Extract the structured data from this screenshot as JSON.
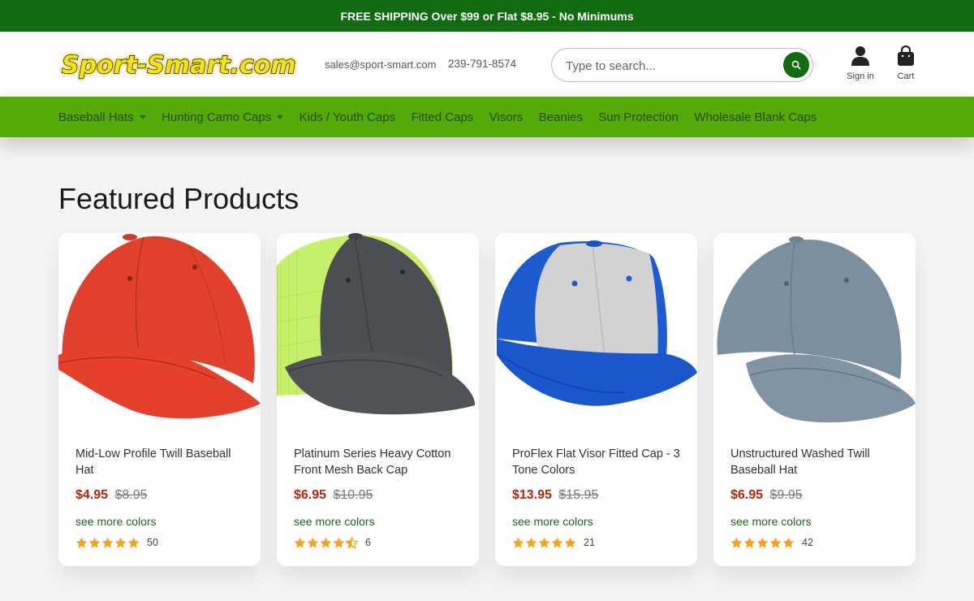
{
  "promo": {
    "text": "FREE SHIPPING Over $99 or Flat $8.95 - No Minimums"
  },
  "header": {
    "logo_text": "Sport-Smart.com",
    "email": "sales@sport-smart.com",
    "phone": "239-791-8574",
    "search_placeholder": "Type to search...",
    "signin_label": "Sign in",
    "cart_label": "Cart"
  },
  "nav": {
    "items": [
      {
        "label": "Baseball Hats",
        "dropdown": true
      },
      {
        "label": "Hunting Camo Caps",
        "dropdown": true
      },
      {
        "label": "Kids / Youth Caps",
        "dropdown": false
      },
      {
        "label": "Fitted Caps",
        "dropdown": false
      },
      {
        "label": "Visors",
        "dropdown": false
      },
      {
        "label": "Beanies",
        "dropdown": false
      },
      {
        "label": "Sun Protection",
        "dropdown": false
      },
      {
        "label": "Wholesale Blank Caps",
        "dropdown": false
      }
    ]
  },
  "featured": {
    "title": "Featured Products",
    "products": [
      {
        "title": "Mid-Low Profile Twill Baseball Hat",
        "price": "$4.95",
        "compare_price": "$8.95",
        "link": "see more colors",
        "rating": 5,
        "reviews": "50",
        "cap_icon": "red-cap"
      },
      {
        "title": "Platinum Series Heavy Cotton Front Mesh Back Cap",
        "price": "$6.95",
        "compare_price": "$10.95",
        "link": "see more colors",
        "rating": 4.5,
        "reviews": "6",
        "cap_icon": "charcoal-neon-mesh-cap"
      },
      {
        "title": "ProFlex Flat Visor Fitted Cap - 3 Tone Colors",
        "price": "$13.95",
        "compare_price": "$15.95",
        "link": "see more colors",
        "rating": 5,
        "reviews": "21",
        "cap_icon": "royal-blue-gray-flat-visor-cap"
      },
      {
        "title": "Unstructured Washed Twill Baseball Hat",
        "price": "$6.95",
        "compare_price": "$9.95",
        "link": "see more colors",
        "rating": 5,
        "reviews": "42",
        "cap_icon": "slate-blue-cap"
      }
    ]
  },
  "colors": {
    "promo_bg": "#116b10",
    "nav_bg": "#54ab07",
    "sale_price": "#b8250c",
    "link": "#196b17",
    "star": "#f5a31b"
  }
}
